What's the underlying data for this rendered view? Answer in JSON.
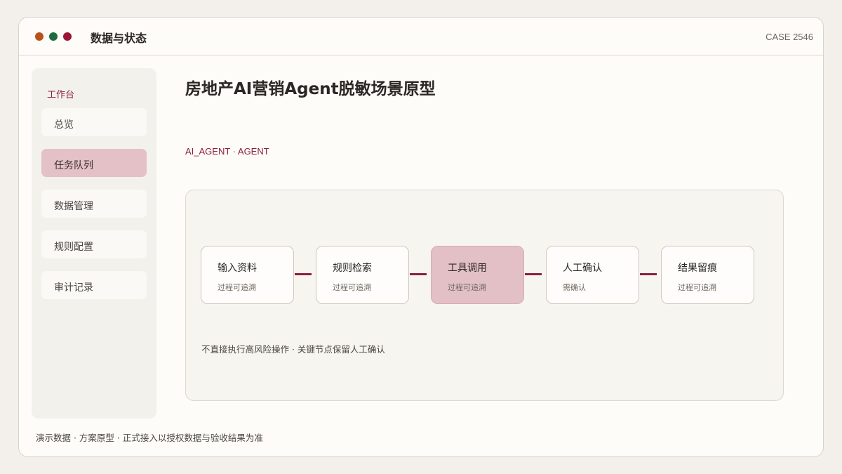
{
  "window": {
    "title": "数据与状态",
    "case_id": "CASE 2546",
    "dot_colors": [
      "#b7521a",
      "#1f6b3d",
      "#9b1537"
    ]
  },
  "sidebar": {
    "heading": "工作台",
    "items": [
      {
        "label": "总览",
        "active": false
      },
      {
        "label": "任务队列",
        "active": true
      },
      {
        "label": "数据管理",
        "active": false
      },
      {
        "label": "规则配置",
        "active": false
      },
      {
        "label": "审计记录",
        "active": false
      }
    ]
  },
  "main": {
    "title": "房地产AI营销Agent脱敏场景原型",
    "subtitle": "AI_AGENT · AGENT",
    "flow": {
      "steps": [
        {
          "title": "输入资料",
          "sub": "过程可追溯",
          "active": false
        },
        {
          "title": "规则检索",
          "sub": "过程可追溯",
          "active": false
        },
        {
          "title": "工具调用",
          "sub": "过程可追溯",
          "active": true
        },
        {
          "title": "人工确认",
          "sub": "需确认",
          "active": false
        },
        {
          "title": "结果留痕",
          "sub": "过程可追溯",
          "active": false
        }
      ],
      "note": "不直接执行高风险操作 · 关键节点保留人工确认"
    }
  },
  "footer": {
    "note": "演示数据 · 方案原型 · 正式接入以授权数据与验收结果为准"
  },
  "colors": {
    "accent": "#8c1f3c",
    "active_fill": "#e3c1c6",
    "background": "#f3f0eb"
  }
}
